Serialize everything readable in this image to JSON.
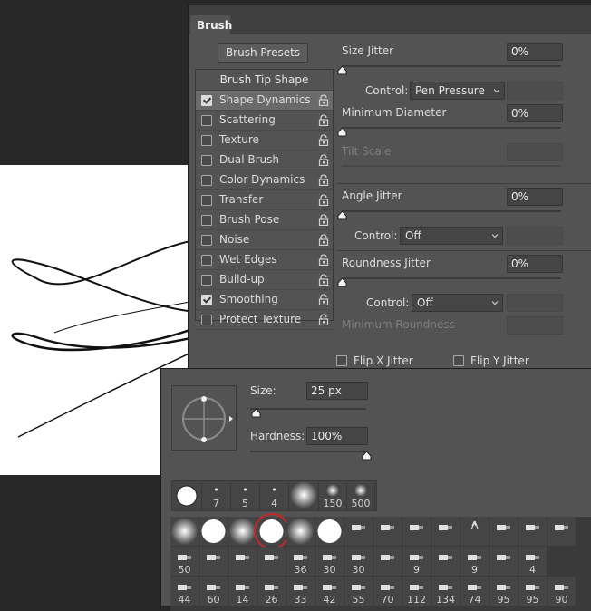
{
  "brush_panel": {
    "tab_label": "Brush",
    "presets_button": "Brush Presets",
    "tip_header": "Brush Tip Shape",
    "tip_items": [
      {
        "label": "Shape Dynamics",
        "checked": true,
        "selected": true
      },
      {
        "label": "Scattering",
        "checked": false
      },
      {
        "label": "Texture",
        "checked": false
      },
      {
        "label": "Dual Brush",
        "checked": false
      },
      {
        "label": "Color Dynamics",
        "checked": false
      },
      {
        "label": "Transfer",
        "checked": false
      },
      {
        "label": "Brush Pose",
        "checked": false
      },
      {
        "label": "Noise",
        "checked": false
      },
      {
        "label": "Wet Edges",
        "checked": false
      },
      {
        "label": "Build-up",
        "checked": false
      },
      {
        "label": "Smoothing",
        "checked": true
      },
      {
        "label": "Protect Texture",
        "checked": false
      }
    ],
    "size_jitter": {
      "label": "Size Jitter",
      "value": "0%"
    },
    "size_control": {
      "label": "Control:",
      "value": "Pen Pressure"
    },
    "min_diameter": {
      "label": "Minimum Diameter",
      "value": "0%"
    },
    "tilt_scale": {
      "label": "Tilt Scale"
    },
    "angle_jitter": {
      "label": "Angle Jitter",
      "value": "0%"
    },
    "angle_control": {
      "label": "Control:",
      "value": "Off"
    },
    "roundness_jitter": {
      "label": "Roundness Jitter",
      "value": "0%"
    },
    "roundness_control": {
      "label": "Control:",
      "value": "Off"
    },
    "min_roundness": {
      "label": "Minimum Roundness"
    },
    "flip_x": {
      "label": "Flip X Jitter",
      "checked": false
    },
    "flip_y": {
      "label": "Flip Y Jitter",
      "checked": false
    }
  },
  "picker": {
    "size": {
      "label": "Size:",
      "value": "25 px",
      "level": 0.05
    },
    "hardness": {
      "label": "Hardness:",
      "value": "100%",
      "level": 1.0
    },
    "recent": [
      {
        "num": "",
        "kind": "hard-big"
      },
      {
        "num": "7",
        "kind": "dot"
      },
      {
        "num": "5",
        "kind": "dot"
      },
      {
        "num": "4",
        "kind": "dot"
      },
      {
        "num": "",
        "kind": "soft-big"
      },
      {
        "num": "150",
        "kind": "soft"
      },
      {
        "num": "500",
        "kind": "soft"
      }
    ],
    "grid_row1": [
      "soft",
      "hard",
      "soft",
      "hard-selected",
      "soft",
      "hard",
      "pen",
      "pen",
      "pen",
      "pen",
      "fan",
      "pen",
      "pen",
      "pen"
    ],
    "grid_row2": [
      "50",
      "",
      "",
      "",
      "36",
      "30",
      "30",
      "",
      "9",
      "",
      "9",
      "",
      "4"
    ],
    "grid_row3": [
      "44",
      "60",
      "14",
      "26",
      "33",
      "42",
      "55",
      "70",
      "112",
      "134",
      "74",
      "95",
      "95",
      "90"
    ]
  },
  "colors": {
    "panel": "#535353",
    "accent_ring": "#c8262b",
    "canvas": "#ffffff"
  }
}
